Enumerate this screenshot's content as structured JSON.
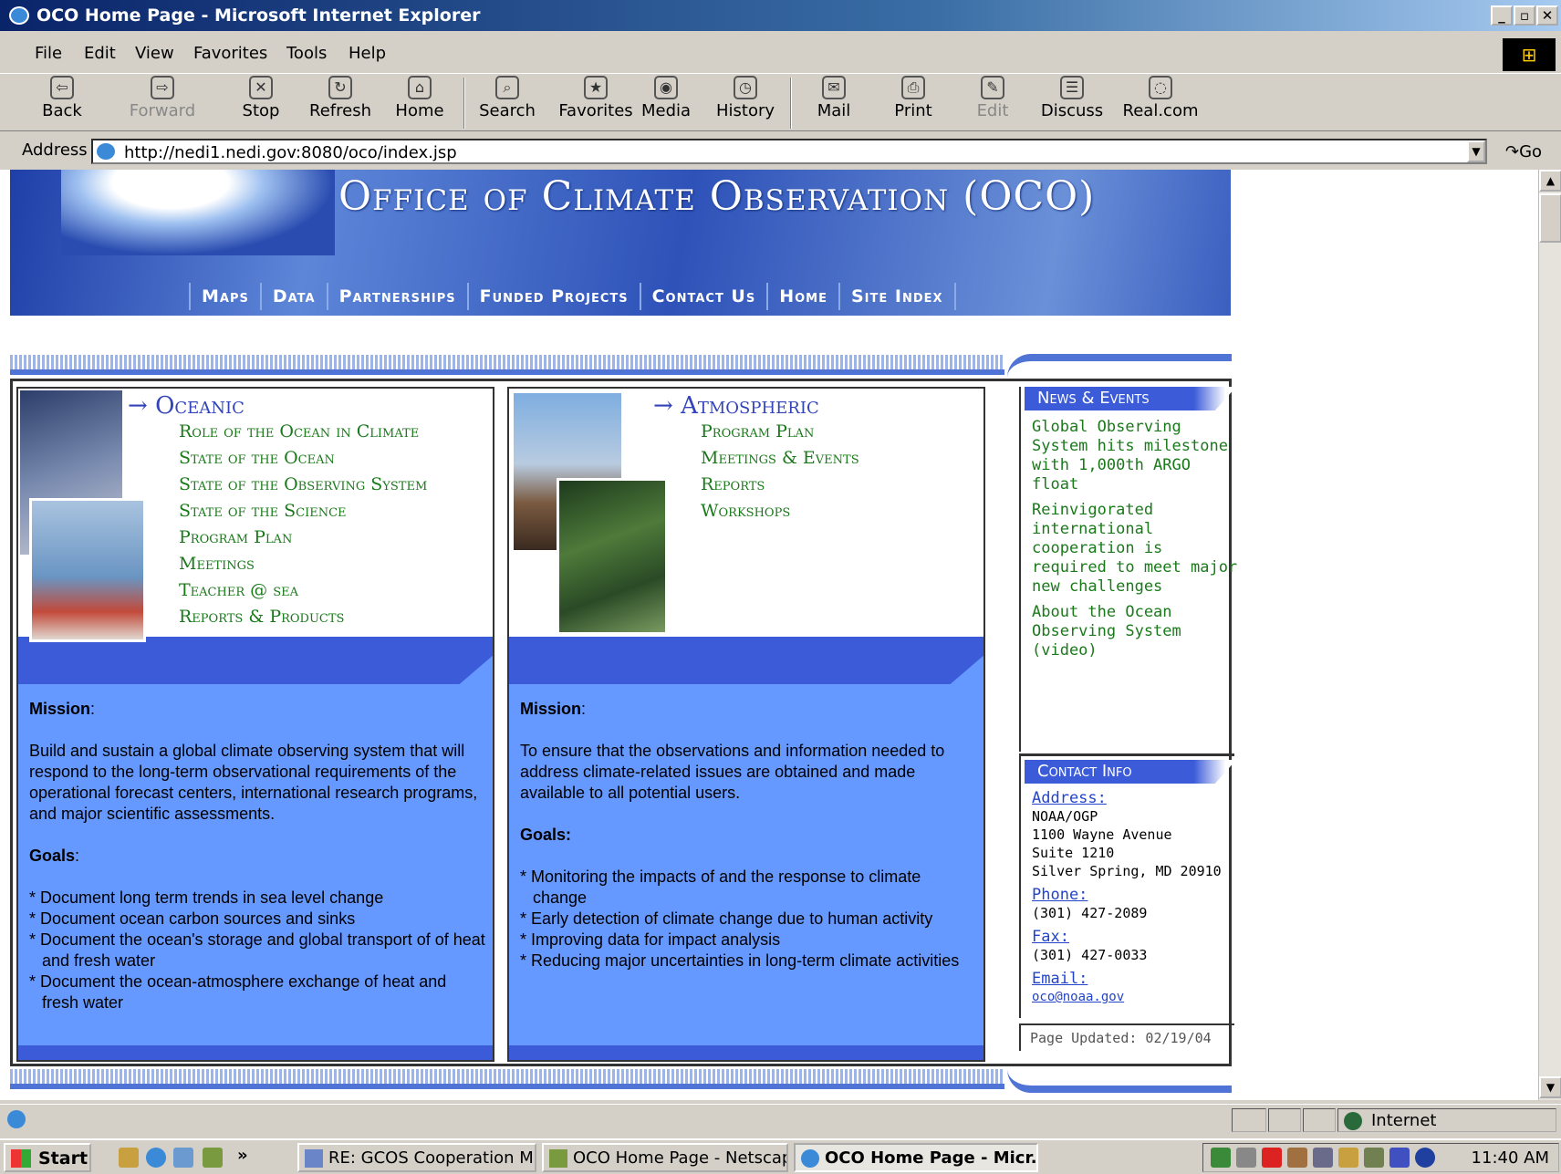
{
  "window": {
    "title": "OCO Home Page - Microsoft Internet Explorer",
    "min": "_",
    "max": "▫",
    "close": "✕"
  },
  "menu": [
    "File",
    "Edit",
    "View",
    "Favorites",
    "Tools",
    "Help"
  ],
  "toolbar": {
    "back": "Back",
    "forward": "Forward",
    "stop": "Stop",
    "refresh": "Refresh",
    "home": "Home",
    "search": "Search",
    "favorites": "Favorites",
    "media": "Media",
    "history": "History",
    "mail": "Mail",
    "print": "Print",
    "edit": "Edit",
    "discuss": "Discuss",
    "real": "Real.com"
  },
  "address": {
    "label": "Address",
    "url": "http://nedi1.nedi.gov:8080/oco/index.jsp",
    "go": "Go"
  },
  "banner": {
    "title": "Office of Climate Observation (OCO)"
  },
  "nav": [
    "Maps",
    "Data",
    "Partnerships",
    "Funded Projects",
    "Contact Us",
    "Home",
    "Site Index"
  ],
  "oceanic": {
    "title": "Oceanic",
    "links": [
      "Role of the Ocean in Climate",
      "State of the Ocean",
      "State of the Observing System",
      "State of the Science",
      "Program Plan",
      "Meetings",
      "Teacher @ sea",
      "Reports & Products"
    ],
    "mission_label": "Mission",
    "mission_text": "Build and sustain a global climate observing system that will respond to the long-term observational requirements of the operational forecast centers, international research programs, and major scientific assessments.",
    "goals_label": "Goals",
    "goals": [
      "* Document long term trends in sea level change",
      "* Document ocean carbon sources and sinks",
      "* Document the ocean's storage and global transport of of heat and fresh water",
      "* Document the ocean-atmosphere exchange of heat and fresh water"
    ]
  },
  "atmospheric": {
    "title": "Atmospheric",
    "links": [
      "Program Plan",
      "Meetings & Events",
      "Reports",
      "Workshops"
    ],
    "mission_label": "Mission",
    "mission_text": "To ensure that the observations and information needed to address climate-related issues are obtained and made available to all potential users.",
    "goals_label": "Goals:",
    "goals": [
      "* Monitoring the impacts of and the response to climate change",
      "* Early detection of climate change due to human activity",
      "* Improving data for impact analysis",
      "* Reducing major uncertainties in long-term climate activities"
    ]
  },
  "news": {
    "title": "News & Events",
    "items": [
      "Global Observing System hits milestone with 1,000th ARGO float",
      "Reinvigorated international cooperation is required to meet major new challenges",
      "About the Ocean Observing System (video)"
    ]
  },
  "contact": {
    "title": "Contact Info",
    "address_label": "Address:",
    "address_lines": [
      "NOAA/OGP",
      "1100 Wayne Avenue",
      "Suite 1210",
      "Silver Spring, MD 20910"
    ],
    "phone_label": "Phone:",
    "phone": "(301) 427-2089",
    "fax_label": "Fax:",
    "fax": "(301) 427-0033",
    "email_label": "Email:",
    "email": "oco@noaa.gov"
  },
  "updated": "Page Updated: 02/19/04",
  "status": {
    "zone": "Internet"
  },
  "taskbar": {
    "start": "Start",
    "more": "»",
    "tasks": [
      "RE: GCOS Cooperation M...",
      "OCO Home Page - Netscape",
      "OCO Home Page - Micr..."
    ],
    "clock": "11:40 AM"
  },
  "colors": {
    "titlebar": "#0a246a",
    "banner": "#2e52b8",
    "panel_blue": "#6699ff",
    "link_green": "#1a7a1a"
  }
}
